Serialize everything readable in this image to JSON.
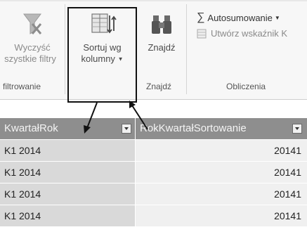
{
  "ribbon": {
    "filter_group": {
      "clear_button_line1": "Wyczyść",
      "clear_button_line2": "szystkie filtry",
      "label": "filtrowanie"
    },
    "sort_group": {
      "sort_button_line1": "Sortuj wg",
      "sort_button_line2": "kolumny"
    },
    "find_group": {
      "find_button": "Znajdź",
      "label": "Znajdź"
    },
    "calc_group": {
      "autosum": "Autosumowanie",
      "create_kpi": "Utwórz wskaźnik K",
      "label": "Obliczenia"
    }
  },
  "grid": {
    "columns": [
      "KwartałRok",
      "RokKwartałSortowanie"
    ],
    "rows": [
      [
        "K1 2014",
        "20141"
      ],
      [
        "K1 2014",
        "20141"
      ],
      [
        "K1 2014",
        "20141"
      ],
      [
        "K1 2014",
        "20141"
      ]
    ]
  },
  "icons": {
    "clear_filters": "funnel-clear-icon",
    "sort_by_column": "sort-by-column-icon",
    "find": "binoculars-icon",
    "autosum": "sigma-icon",
    "kpi": "kpi-icon"
  }
}
